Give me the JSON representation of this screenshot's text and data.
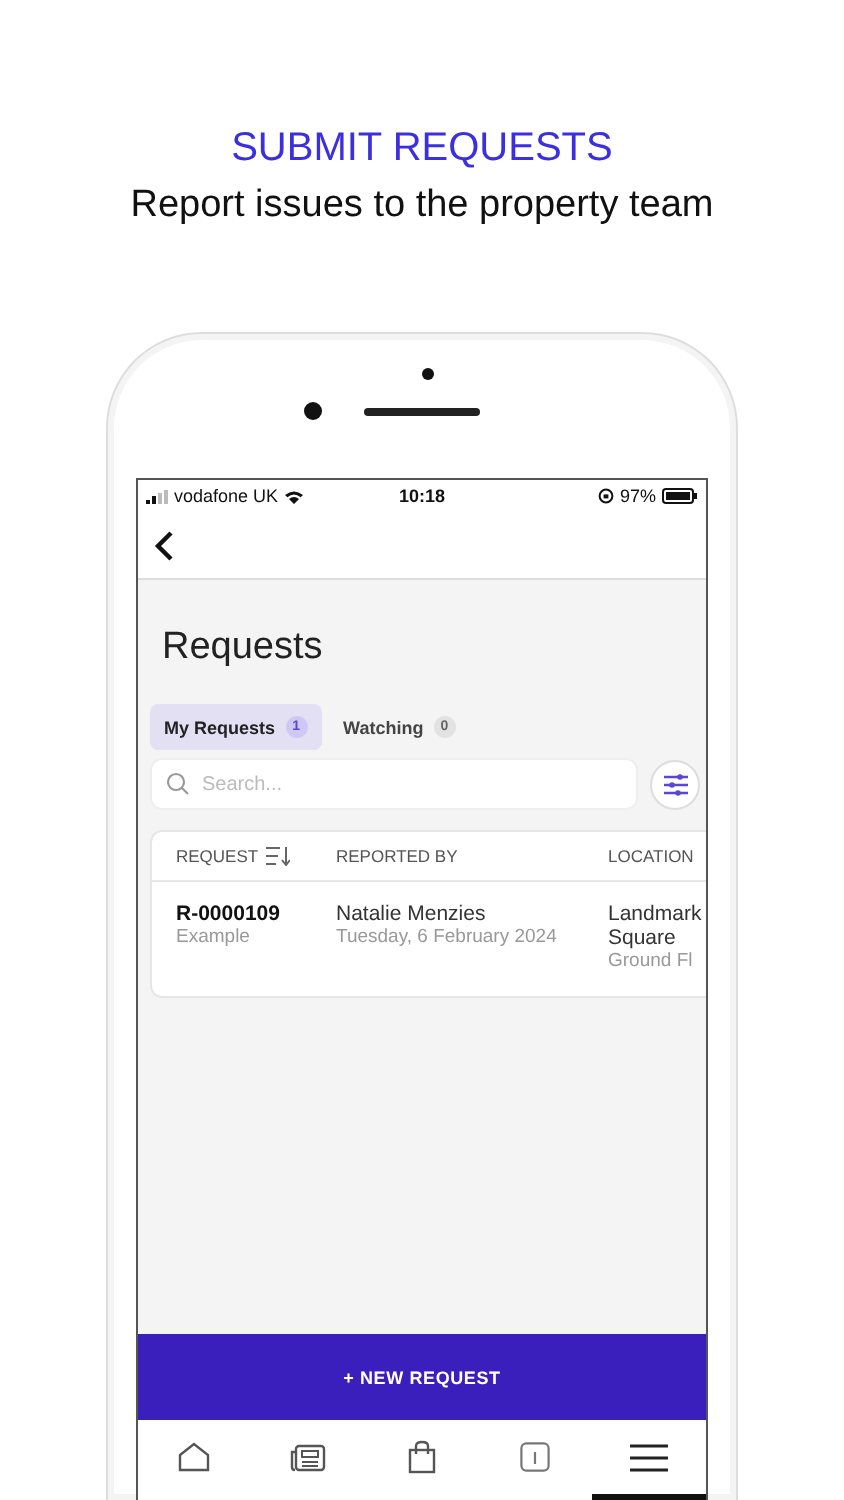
{
  "heading": {
    "title": "SUBMIT REQUESTS",
    "subtitle": "Report issues to the property team"
  },
  "status_bar": {
    "carrier": "vodafone UK",
    "time": "10:18",
    "battery": "97%"
  },
  "page_title": "Requests",
  "tabs": [
    {
      "label": "My Requests",
      "count": "1",
      "selected": true
    },
    {
      "label": "Watching",
      "count": "0",
      "selected": false
    }
  ],
  "search": {
    "placeholder": "Search..."
  },
  "table": {
    "columns": [
      {
        "label": "REQUEST",
        "sortable": true
      },
      {
        "label": "REPORTED BY",
        "sortable": false
      },
      {
        "label": "LOCATION",
        "sortable": false
      }
    ],
    "rows": [
      {
        "id": "R-0000109",
        "type": "Example",
        "reporter": "Natalie Menzies",
        "date": "Tuesday, 6 February 2024",
        "location": [
          "Landmark",
          "Square"
        ],
        "floor": "Ground Fl"
      }
    ]
  },
  "new_request_button": "+ NEW REQUEST",
  "bottom_nav": [
    {
      "kind": "home",
      "selected": false
    },
    {
      "kind": "news",
      "selected": false
    },
    {
      "kind": "bag",
      "selected": false
    },
    {
      "kind": "info",
      "selected": false
    },
    {
      "kind": "menu",
      "selected": true
    }
  ]
}
